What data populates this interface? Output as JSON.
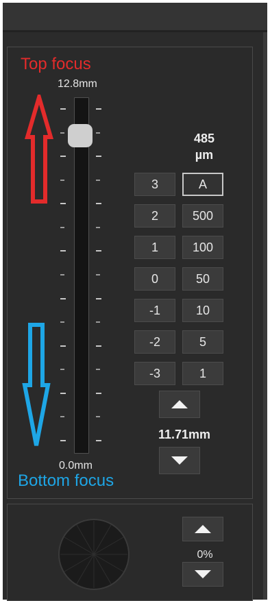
{
  "focus": {
    "top_label": "Top focus",
    "bottom_label": "Bottom focus",
    "scale_max": "12.8mm",
    "scale_min": "0.0mm",
    "slider_fraction": 0.92,
    "colors": {
      "top": "#e32b2b",
      "bottom": "#1ea6e6"
    }
  },
  "step": {
    "value_line1": "485",
    "value_line2": "µm",
    "levels": [
      "3",
      "2",
      "1",
      "0",
      "-1",
      "-2",
      "-3"
    ],
    "sizes": [
      "A",
      "500",
      "100",
      "50",
      "10",
      "5",
      "1"
    ],
    "selected_size": "A"
  },
  "position": {
    "value": "11.71mm"
  },
  "lower": {
    "percent": "0%"
  },
  "icons": {
    "top_arrow": "arrow-up-outline-icon",
    "bottom_arrow": "arrow-down-outline-icon",
    "up": "triangle-up-icon",
    "down": "triangle-down-icon",
    "dial": "aperture-dial-icon"
  }
}
